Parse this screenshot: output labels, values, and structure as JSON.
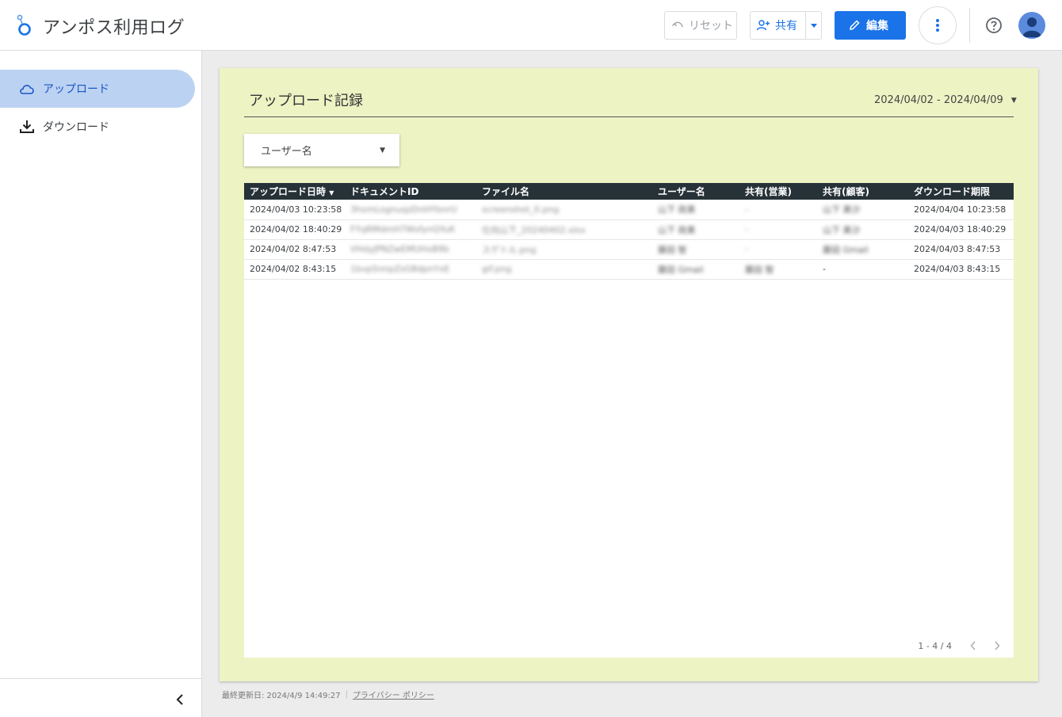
{
  "app": {
    "title": "アンポス利用ログ"
  },
  "toolbar": {
    "reset_label": "リセット",
    "share_label": "共有",
    "edit_label": "編集"
  },
  "colors": {
    "accent": "#1a73e8",
    "report_bg": "#eef3c4",
    "table_header": "#263238",
    "nav_active": "#bcd2f2"
  },
  "sidebar": {
    "items": [
      {
        "label": "アップロード",
        "icon": "cloud-icon",
        "active": true
      },
      {
        "label": "ダウンロード",
        "icon": "download-icon",
        "active": false
      }
    ]
  },
  "report": {
    "title": "アップロード記録",
    "date_range": "2024/04/02 - 2024/04/09",
    "filter_label": "ユーザー名",
    "columns": [
      "アップロード日時",
      "ドキュメントID",
      "ファイル名",
      "ユーザー名",
      "共有(営業)",
      "共有(顧客)",
      "ダウンロード期限"
    ],
    "sort_indicator": "▼",
    "rows": [
      [
        "2024/04/03 10:23:58",
        "3hxmLognuqzDnHYbnrU",
        "screenshot_0.png",
        "山下 政美",
        "-",
        "山下 美沙",
        "2024/04/04 10:23:58"
      ],
      [
        "2024/04/02 18:40:29",
        "FYqRMdmH7WsfynQYuK",
        "仕向山下_20240402.xlsx",
        "山下 政美",
        "-",
        "山下 美沙",
        "2024/04/03 18:40:29"
      ],
      [
        "2024/04/02 8:47:53",
        "VHdyJPNZwEMUHxB9b",
        "スゲトル.png",
        "藤田 智",
        "-",
        "藤田 Gmail",
        "2024/04/03 8:47:53"
      ],
      [
        "2024/04/02 8:43:15",
        "1bvpSnnpZsG8dpnYxE",
        "gif.png",
        "藤田 Gmail",
        "藤田 智",
        "-",
        "2024/04/03 8:43:15"
      ]
    ],
    "pagination": "1 - 4 / 4"
  },
  "footer": {
    "last_updated": "最終更新日: 2024/4/9 14:49:27",
    "privacy": "プライバシー ポリシー"
  }
}
